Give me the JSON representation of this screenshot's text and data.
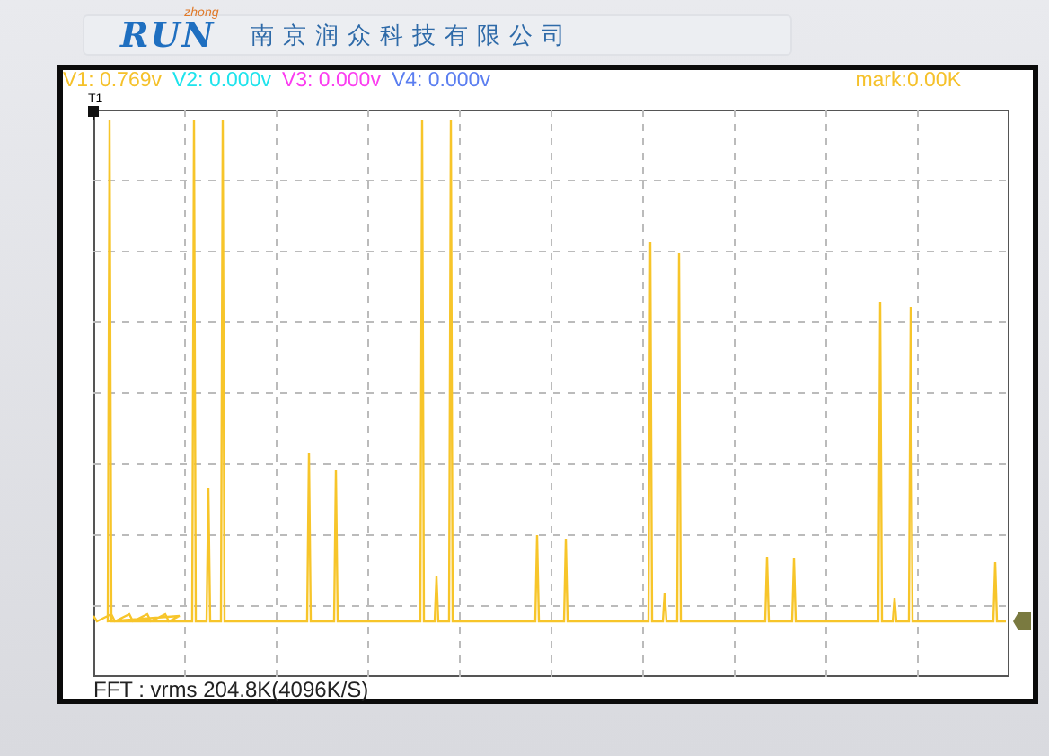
{
  "header": {
    "logo_text": "RUN",
    "logo_subtext": "zhong",
    "company": "南京润众科技有限公司"
  },
  "readouts": [
    {
      "label": "V1: 0.769v",
      "color": "#f5c12a"
    },
    {
      "label": "V2: 0.000v",
      "color": "#1ee3ec"
    },
    {
      "label": "V3: 0.000v",
      "color": "#fb3df0"
    },
    {
      "label": "V4: 0.000v",
      "color": "#5b7ef0"
    }
  ],
  "mark": "mark:0.00K",
  "cursor_label": "T1",
  "footer": "FFT : vrms 204.8K(4096K/S)"
}
